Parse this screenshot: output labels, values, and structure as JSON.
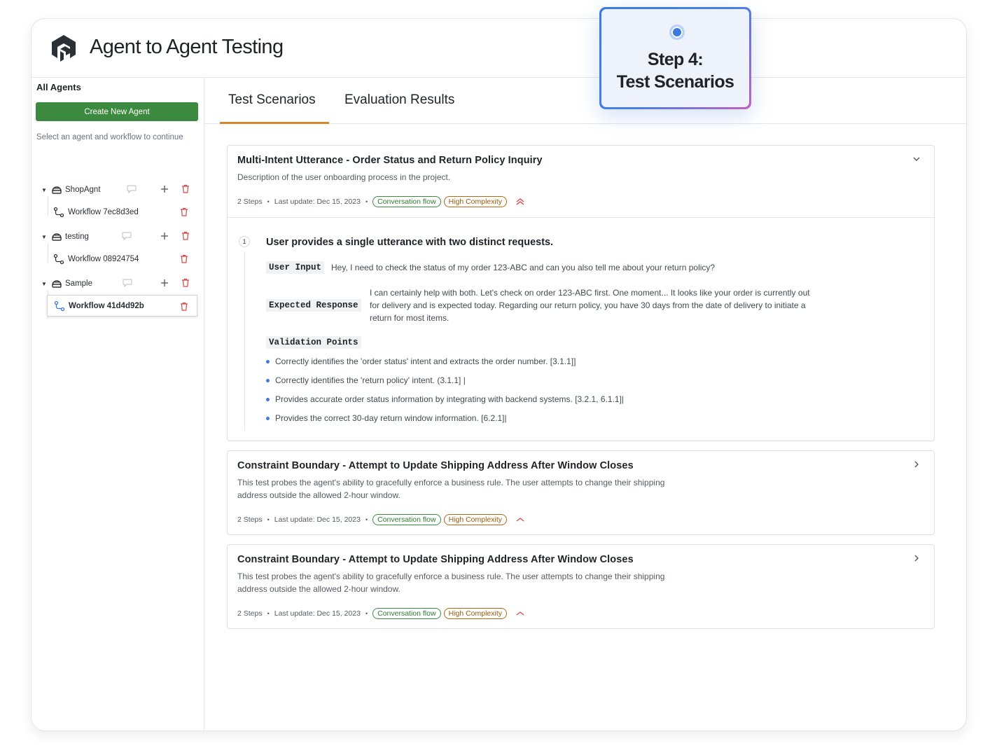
{
  "app": {
    "title": "Agent to Agent Testing"
  },
  "sidebar": {
    "heading": "All Agents",
    "create_label": "Create New Agent",
    "hint": "Select an agent and workflow to continue",
    "agents": [
      {
        "name": "ShopAgnt",
        "workflow": "Workflow 7ec8d3ed"
      },
      {
        "name": "testing",
        "workflow": "Workflow 08924754"
      },
      {
        "name": "Sample",
        "workflow": "Workflow 41d4d92b"
      }
    ]
  },
  "tabs": [
    "Test Scenarios",
    "Evaluation Results"
  ],
  "step_badge": {
    "line1": "Step 4:",
    "line2": "Test Scenarios"
  },
  "scenarios": [
    {
      "title": "Multi-Intent Utterance - Order Status and Return Policy Inquiry",
      "description": "Description of the user onboarding process in the project.",
      "steps": "2 Steps",
      "updated": "Last update: Dec 15, 2023",
      "tag1": "Conversation flow",
      "tag2": "High Complexity",
      "step": {
        "number": "1",
        "title": "User provides a single utterance with two distinct requests.",
        "user_input_label": "User Input",
        "user_input": "Hey, I need to check the status of my order 123-ABC and can you also tell me about your return policy?",
        "expected_label": "Expected Response",
        "expected_1": "I can certainly help with both. Let's check on order 123-ABC first. One moment... It looks like your order is currently out",
        "expected_2": "for delivery and is expected today. Regarding our return policy, you have 30 days from the date of delivery to initiate a",
        "expected_3": "return for most items.",
        "validation_label": "Validation Points",
        "points": [
          "Correctly identifies the 'order status' intent and extracts the order number. [3.1.1]]",
          "Correctly identifies the 'return policy' intent. (3.1.1] |",
          "Provides accurate order status information by integrating with backend systems. [3.2.1, 6.1.1]|",
          "Provides the correct 30-day return window information. [6.2.1]|"
        ]
      }
    },
    {
      "title": "Constraint Boundary - Attempt to Update Shipping Address After Window Closes",
      "desc_1": "This test probes the agent's ability to gracefully enforce a business rule. The user attempts to change their shipping",
      "desc_2": "address outside the allowed 2-hour window.",
      "steps": "2 Steps",
      "updated": "Last update: Dec 15, 2023",
      "tag1": "Conversation flow",
      "tag2": "High Complexity"
    },
    {
      "title": "Constraint Boundary - Attempt to Update Shipping Address After Window Closes",
      "desc_1": "This test probes the agent's ability to gracefully enforce a business rule. The user attempts to change their shipping",
      "desc_2": "address outside the allowed 2-hour window.",
      "steps": "2 Steps",
      "updated": "Last update: Dec 15, 2023",
      "tag1": "Conversation flow",
      "tag2": "High Complexity"
    }
  ],
  "colors": {
    "accent_green": "#3c8a3f",
    "tab_underline": "#d2882f",
    "danger": "#d64545",
    "info_blue": "#3b7be0"
  }
}
